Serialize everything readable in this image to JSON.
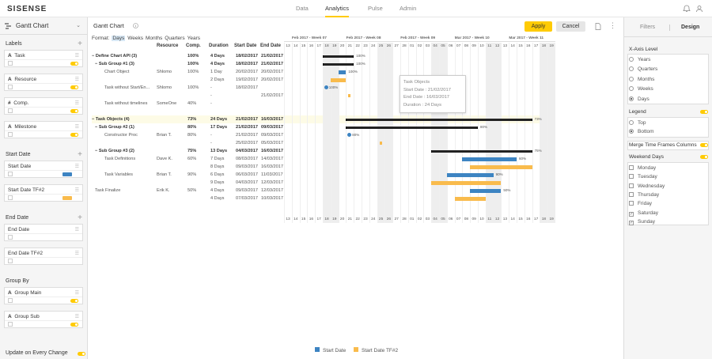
{
  "app": {
    "logo": "SISENSE",
    "nav": [
      "Data",
      "Analytics",
      "Pulse",
      "Admin"
    ],
    "active_nav": "Analytics"
  },
  "left": {
    "widget_type": "Gantt Chart",
    "sections": {
      "labels": "Labels",
      "start_date": "Start Date",
      "end_date": "End Date",
      "group_by": "Group By"
    },
    "labels": [
      {
        "type": "A",
        "name": "Task"
      },
      {
        "type": "A",
        "name": "Resource"
      },
      {
        "type": "#",
        "name": "Comp."
      },
      {
        "type": "A",
        "name": "Milestone"
      }
    ],
    "start_dates": [
      {
        "name": "Start Date",
        "color": "#3d84c2"
      },
      {
        "name": "Start Date TF#2",
        "color": "#f9bb4c"
      }
    ],
    "end_dates": [
      {
        "name": "End Date"
      },
      {
        "name": "End Date TF#2"
      }
    ],
    "group_by": [
      {
        "type": "A",
        "name": "Group Main"
      },
      {
        "type": "A",
        "name": "Group Sub"
      }
    ],
    "update_label": "Update on Every Change"
  },
  "main": {
    "title": "Gantt Chart",
    "apply": "Apply",
    "cancel": "Cancel",
    "format": [
      "Format:",
      "Days",
      "Weeks",
      "Months",
      "Quarters",
      "Years"
    ],
    "format_selected": "Days",
    "columns": [
      "Resource",
      "Comp.",
      "Duration",
      "Start Date",
      "End Date"
    ],
    "rows": [
      {
        "task": "Define Chart API (3)",
        "res": "",
        "comp": "100%",
        "dur": "4 Days",
        "start": "18/02/2017",
        "end": "21/02/2017",
        "lvl": 0,
        "bold": true
      },
      {
        "task": "Sub Group #1 (3)",
        "res": "",
        "comp": "100%",
        "dur": "4 Days",
        "start": "18/02/2017",
        "end": "21/02/2017",
        "lvl": 1,
        "bold": true
      },
      {
        "task": "Chart Object",
        "res": "Shlomo",
        "comp": "100%",
        "dur": "1 Day",
        "start": "20/02/2017",
        "end": "20/02/2017",
        "lvl": 2
      },
      {
        "task": "",
        "res": "",
        "comp": "",
        "dur": "2 Days",
        "start": "19/02/2017",
        "end": "20/02/2017",
        "lvl": 2
      },
      {
        "task": "Task without Start/En...",
        "res": "Shlomo",
        "comp": "100%",
        "dur": "-",
        "start": "18/02/2017",
        "end": "",
        "lvl": 2
      },
      {
        "task": "",
        "res": "",
        "comp": "",
        "dur": "-",
        "start": "",
        "end": "21/02/2017",
        "lvl": 2
      },
      {
        "task": "Task without timelines",
        "res": "SomeOne",
        "comp": "40%",
        "dur": "-",
        "start": "",
        "end": "",
        "lvl": 2
      },
      {
        "task": "",
        "res": "",
        "comp": "",
        "dur": "",
        "start": "",
        "end": "",
        "lvl": 2
      },
      {
        "task": "Task Objects (4)",
        "res": "",
        "comp": "73%",
        "dur": "24 Days",
        "start": "21/02/2017",
        "end": "16/03/2017",
        "lvl": 0,
        "bold": true,
        "hl": true
      },
      {
        "task": "Sub Group #2 (1)",
        "res": "",
        "comp": "80%",
        "dur": "17 Days",
        "start": "21/02/2017",
        "end": "09/03/2017",
        "lvl": 1,
        "bold": true
      },
      {
        "task": "Constructor Proc",
        "res": "Brian T.",
        "comp": "80%",
        "dur": "-",
        "start": "21/02/2017",
        "end": "09/03/2017",
        "lvl": 2
      },
      {
        "task": "",
        "res": "",
        "comp": "",
        "dur": "-",
        "start": "25/02/2017",
        "end": "05/03/2017",
        "lvl": 2
      },
      {
        "task": "Sub Group #3 (2)",
        "res": "",
        "comp": "75%",
        "dur": "13 Days",
        "start": "04/03/2017",
        "end": "16/03/2017",
        "lvl": 1,
        "bold": true
      },
      {
        "task": "Task Definitions",
        "res": "Dave K.",
        "comp": "60%",
        "dur": "7 Days",
        "start": "08/03/2017",
        "end": "14/03/2017",
        "lvl": 2
      },
      {
        "task": "",
        "res": "",
        "comp": "",
        "dur": "8 Days",
        "start": "09/03/2017",
        "end": "16/03/2017",
        "lvl": 2
      },
      {
        "task": "Task Variables",
        "res": "Brian T.",
        "comp": "90%",
        "dur": "6 Days",
        "start": "06/03/2017",
        "end": "11/03/2017",
        "lvl": 2
      },
      {
        "task": "",
        "res": "",
        "comp": "",
        "dur": "9 Days",
        "start": "04/03/2017",
        "end": "12/03/2017",
        "lvl": 2
      },
      {
        "task": "Task Finalize",
        "res": "Erik K.",
        "comp": "50%",
        "dur": "4 Days",
        "start": "09/03/2017",
        "end": "12/03/2017",
        "lvl": 1
      },
      {
        "task": "",
        "res": "",
        "comp": "",
        "dur": "4 Days",
        "start": "07/03/2017",
        "end": "10/03/2017",
        "lvl": 1
      }
    ],
    "weeks": [
      "Feb 2017 - Week 07",
      "Feb 2017 - Week 08",
      "Feb 2017 - Week 09",
      "Mar 2017 - Week 10",
      "Mar 2017 - Week 11"
    ],
    "days": [
      13,
      14,
      15,
      16,
      17,
      18,
      19,
      20,
      21,
      22,
      23,
      24,
      25,
      26,
      27,
      28,
      "01",
      "02",
      "03",
      "04",
      "05",
      "06",
      "07",
      "08",
      "09",
      10,
      11,
      12,
      13,
      14,
      15,
      16,
      17,
      18,
      19
    ],
    "bars": [
      {
        "row": 0,
        "s": 18,
        "e": 21,
        "color": "#222",
        "pct": "100%",
        "summary": true
      },
      {
        "row": 1,
        "s": 18,
        "e": 21,
        "color": "#222",
        "pct": "100%",
        "summary": true
      },
      {
        "row": 2,
        "s": 20,
        "e": 20,
        "color": "#3d84c2",
        "pct": "100%"
      },
      {
        "row": 3,
        "s": 19,
        "e": 20,
        "color": "#f9bb4c",
        "pct": ""
      },
      {
        "row": 4,
        "s": 18,
        "e": 18,
        "color": "#3d84c2",
        "pct": "100%",
        "milestone": true
      },
      {
        "row": 5,
        "s": 21,
        "e": 21,
        "color": "#f9bb4c",
        "pct": "",
        "dot": true
      },
      {
        "row": 8,
        "s": 21,
        "e": 44,
        "color": "#222",
        "pct": "73%",
        "summary": true
      },
      {
        "row": 9,
        "s": 21,
        "e": 37,
        "color": "#222",
        "pct": "80%",
        "summary": true
      },
      {
        "row": 10,
        "s": 21,
        "e": 21,
        "color": "#3d84c2",
        "pct": "80%",
        "milestone": true
      },
      {
        "row": 11,
        "s": 25,
        "e": 25,
        "color": "#f9bb4c",
        "pct": "",
        "dot": true
      },
      {
        "row": 12,
        "s": 32,
        "e": 44,
        "color": "#222",
        "pct": "75%",
        "summary": true
      },
      {
        "row": 13,
        "s": 36,
        "e": 42,
        "color": "#3d84c2",
        "pct": "60%"
      },
      {
        "row": 14,
        "s": 37,
        "e": 44,
        "color": "#f9bb4c",
        "pct": ""
      },
      {
        "row": 15,
        "s": 34,
        "e": 39,
        "color": "#3d84c2",
        "pct": "90%"
      },
      {
        "row": 16,
        "s": 32,
        "e": 40,
        "color": "#f9bb4c",
        "pct": ""
      },
      {
        "row": 17,
        "s": 37,
        "e": 40,
        "color": "#3d84c2",
        "pct": "50%"
      },
      {
        "row": 18,
        "s": 35,
        "e": 38,
        "color": "#f9bb4c",
        "pct": ""
      }
    ],
    "tooltip": {
      "title": "Task Objects",
      "start": "Start Date : 21/02/2017",
      "end": "End Date : 16/03/2017",
      "dur": "Duration : 24 Days"
    },
    "legend": [
      {
        "name": "Start Date",
        "color": "#3d84c2"
      },
      {
        "name": "Start Date TF#2",
        "color": "#f9bb4c"
      }
    ]
  },
  "right": {
    "tabs": [
      "Filters",
      "Design"
    ],
    "active_tab": "Design",
    "xaxis_label": "X-Axis Level",
    "xaxis_opts": [
      "Years",
      "Quarters",
      "Months",
      "Weeks",
      "Days"
    ],
    "xaxis_sel": "Days",
    "legend_label": "Legend",
    "legend_opts": [
      "Top",
      "Bottom"
    ],
    "legend_sel": "Bottom",
    "merge_label": "Merge Time Frames Columns",
    "weekend_label": "Weekend Days",
    "days": [
      {
        "n": "Monday",
        "c": false
      },
      {
        "n": "Tuesday",
        "c": false
      },
      {
        "n": "Wednesday",
        "c": false
      },
      {
        "n": "Thursday",
        "c": false
      },
      {
        "n": "Friday",
        "c": false
      },
      {
        "n": "Saturday",
        "c": true
      },
      {
        "n": "Sunday",
        "c": true
      }
    ]
  }
}
